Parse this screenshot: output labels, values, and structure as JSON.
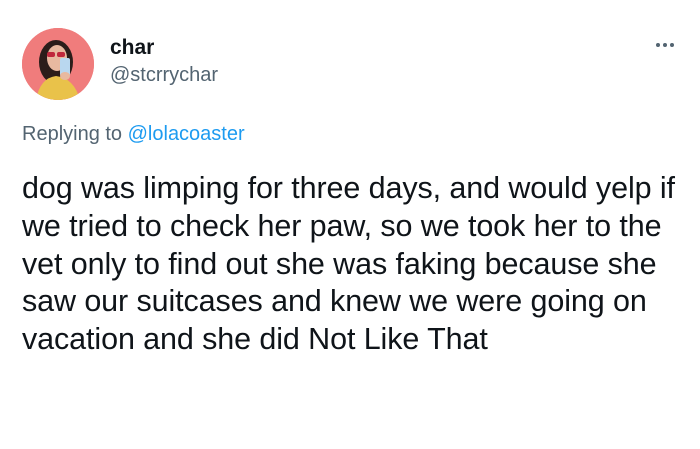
{
  "author": {
    "display_name": "char",
    "handle": "@stcrrychar",
    "avatar_icon": "profile-photo-avatar"
  },
  "more_icon": "more-horizontal-icon",
  "reply": {
    "prefix": "Replying to",
    "mention": "@lolacoaster"
  },
  "tweet": {
    "text": "dog was limping for three days, and would yelp if we tried to check her paw, so we took her to the vet only to find out she was faking because she saw our suitcases and knew we were going on vacation and she did Not Like That"
  },
  "colors": {
    "primary_text": "#0f1419",
    "secondary_text": "#536471",
    "link": "#1d9bf0",
    "avatar_bg": "#f07c7c"
  }
}
